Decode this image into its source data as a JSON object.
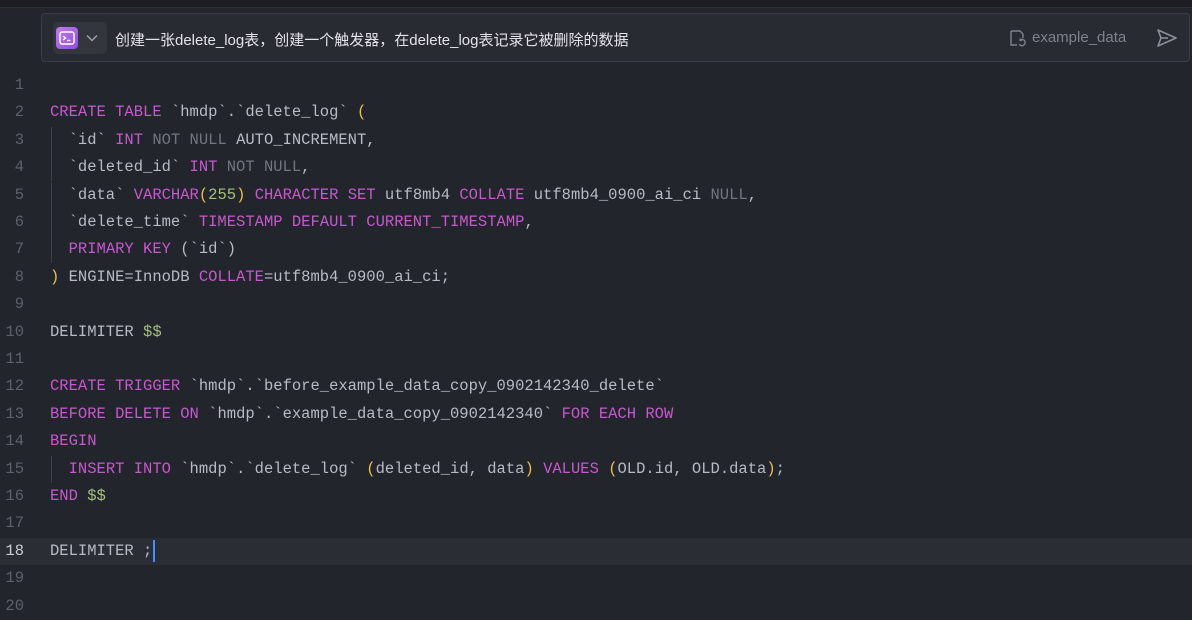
{
  "prompt": {
    "text": "创建一张delete_log表，创建一个触发器，在delete_log表记录它被删除的数据",
    "database": "example_data"
  },
  "editor": {
    "active_line": 18,
    "lines": [
      {
        "n": "1",
        "tokens": []
      },
      {
        "n": "2",
        "tokens": [
          [
            "CREATE",
            "kw"
          ],
          [
            " ",
            "id"
          ],
          [
            "TABLE",
            "kw"
          ],
          [
            " `hmdp`.`delete_log` ",
            "id"
          ],
          [
            "(",
            "par"
          ]
        ]
      },
      {
        "n": "3",
        "guide": true,
        "tokens": [
          [
            "  `id` ",
            "id"
          ],
          [
            "INT",
            "kw"
          ],
          [
            " ",
            "id"
          ],
          [
            "NOT NULL",
            "mut"
          ],
          [
            " AUTO_INCREMENT,",
            "id"
          ]
        ]
      },
      {
        "n": "4",
        "guide": true,
        "tokens": [
          [
            "  `deleted_id` ",
            "id"
          ],
          [
            "INT",
            "kw"
          ],
          [
            " ",
            "id"
          ],
          [
            "NOT NULL",
            "mut"
          ],
          [
            ",",
            "id"
          ]
        ]
      },
      {
        "n": "5",
        "guide": true,
        "tokens": [
          [
            "  `data` ",
            "id"
          ],
          [
            "VARCHAR",
            "kw"
          ],
          [
            "(",
            "par"
          ],
          [
            "255",
            "num"
          ],
          [
            ")",
            "par"
          ],
          [
            " ",
            "id"
          ],
          [
            "CHARACTER SET",
            "kw"
          ],
          [
            " utf8mb4 ",
            "id"
          ],
          [
            "COLLATE",
            "kw"
          ],
          [
            " utf8mb4_0900_ai_ci ",
            "id"
          ],
          [
            "NULL",
            "mut"
          ],
          [
            ",",
            "id"
          ]
        ]
      },
      {
        "n": "6",
        "guide": true,
        "tokens": [
          [
            "  `delete_time` ",
            "id"
          ],
          [
            "TIMESTAMP",
            "kw"
          ],
          [
            " ",
            "id"
          ],
          [
            "DEFAULT",
            "kw"
          ],
          [
            " ",
            "id"
          ],
          [
            "CURRENT_TIMESTAMP",
            "fn"
          ],
          [
            ",",
            "id"
          ]
        ]
      },
      {
        "n": "7",
        "guide": true,
        "tokens": [
          [
            "  ",
            "id"
          ],
          [
            "PRIMARY KEY",
            "kw"
          ],
          [
            " (`id`)",
            "id"
          ]
        ]
      },
      {
        "n": "8",
        "tokens": [
          [
            ")",
            "par"
          ],
          [
            " ENGINE=InnoDB ",
            "id"
          ],
          [
            "COLLATE",
            "kw"
          ],
          [
            "=utf8mb4_0900_ai_ci;",
            "id"
          ]
        ]
      },
      {
        "n": "9",
        "tokens": []
      },
      {
        "n": "10",
        "tokens": [
          [
            "DELIMITER ",
            "id"
          ],
          [
            "$$",
            "dol"
          ]
        ]
      },
      {
        "n": "11",
        "tokens": []
      },
      {
        "n": "12",
        "tokens": [
          [
            "CREATE",
            "kw"
          ],
          [
            " ",
            "id"
          ],
          [
            "TRIGGER",
            "kw"
          ],
          [
            " `hmdp`.`before_example_data_copy_0902142340_delete`",
            "id"
          ]
        ]
      },
      {
        "n": "13",
        "tokens": [
          [
            "BEFORE",
            "kw"
          ],
          [
            " ",
            "id"
          ],
          [
            "DELETE",
            "kw"
          ],
          [
            " ",
            "id"
          ],
          [
            "ON",
            "kw"
          ],
          [
            " `hmdp`.`example_data_copy_0902142340` ",
            "id"
          ],
          [
            "FOR EACH ROW",
            "kw"
          ]
        ]
      },
      {
        "n": "14",
        "tokens": [
          [
            "BEGIN",
            "kw"
          ]
        ]
      },
      {
        "n": "15",
        "guide": true,
        "tokens": [
          [
            "  ",
            "id"
          ],
          [
            "INSERT",
            "kw"
          ],
          [
            " ",
            "id"
          ],
          [
            "INTO",
            "kw"
          ],
          [
            " `hmdp`.`delete_log` ",
            "id"
          ],
          [
            "(",
            "par"
          ],
          [
            "deleted_id, data",
            "id"
          ],
          [
            ")",
            "par"
          ],
          [
            " ",
            "id"
          ],
          [
            "VALUES",
            "kw"
          ],
          [
            " ",
            "id"
          ],
          [
            "(",
            "par"
          ],
          [
            "OLD.id, OLD.data",
            "id"
          ],
          [
            ")",
            "par"
          ],
          [
            ";",
            "id"
          ]
        ]
      },
      {
        "n": "16",
        "tokens": [
          [
            "END",
            "kw"
          ],
          [
            " ",
            "id"
          ],
          [
            "$$",
            "dol"
          ]
        ]
      },
      {
        "n": "17",
        "tokens": []
      },
      {
        "n": "18",
        "tokens": [
          [
            "DELIMITER ;",
            "id"
          ]
        ],
        "cursor": true
      },
      {
        "n": "19",
        "tokens": []
      },
      {
        "n": "20",
        "tokens": []
      }
    ]
  },
  "colors": {
    "background": "#22252b",
    "keyword": "#c758cf",
    "paren": "#e6c14b",
    "number": "#a5c07c",
    "cursor": "#4a8cf7"
  },
  "icons": {
    "ai": "terminal-sparkle-icon",
    "dropdown": "chevron-down-icon",
    "database": "database-switch-icon",
    "send": "send-icon"
  }
}
